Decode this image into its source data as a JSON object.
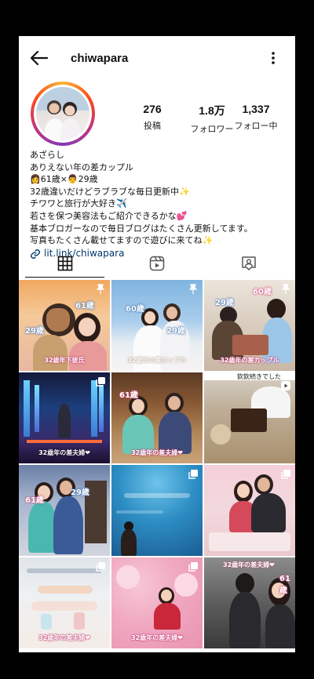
{
  "header": {
    "username": "chiwapara"
  },
  "stats": [
    {
      "number": "276",
      "label": "投稿"
    },
    {
      "number": "1.8万",
      "label": "フォロワー"
    },
    {
      "number": "1,337",
      "label": "フォロー中"
    }
  ],
  "bio": {
    "name": "あざらし",
    "lines": [
      "ありえない年の差カップル",
      "👩61歳×👨29歳",
      "32歳違いだけどラブラブな毎日更新中✨",
      "チワワと旅行が大好き✈️",
      "若さを保つ美容法もご紹介できるかな💕",
      "基本ブロガーなので毎日ブログはたくさん更新してます。",
      "写真もたくさん載せてますので遊びに来てね✨"
    ],
    "link": "lit.link/chiwapara"
  },
  "tabs": [
    {
      "icon": "grid-icon",
      "active": true
    },
    {
      "icon": "reels-icon",
      "active": false
    },
    {
      "icon": "tagged-icon",
      "active": false
    }
  ],
  "posts": [
    {
      "caption": "32歳年下彼氏",
      "ages": [
        "61歳",
        "29歳"
      ],
      "badge": "pin-icon"
    },
    {
      "caption": "32歳年の差カップル",
      "ages": [
        "60歳",
        "29歳"
      ],
      "badge": "pin-icon"
    },
    {
      "caption": "32歳年の差カップル",
      "ages": [
        "29歳",
        "60歳"
      ],
      "badge": "pin-icon"
    },
    {
      "caption": "32歳年の差夫婦❤",
      "ages": [],
      "badge": "multi-icon"
    },
    {
      "caption": "32歳年の差夫婦❤",
      "ages": [
        "61歳"
      ],
      "badge": "none"
    },
    {
      "caption": "",
      "ages": [],
      "badge": "reel-icon",
      "top_text": "欽欽続きでした"
    },
    {
      "caption": "",
      "ages": [
        "61歳",
        "29歳"
      ],
      "badge": "none"
    },
    {
      "caption": "",
      "ages": [],
      "badge": "multi-icon"
    },
    {
      "caption": "",
      "ages": [],
      "badge": "multi-icon"
    },
    {
      "caption": "32歳年の差夫婦❤",
      "ages": [],
      "badge": "multi-icon"
    },
    {
      "caption": "32歳年の差夫婦❤",
      "ages": [],
      "badge": "multi-icon"
    },
    {
      "caption": "",
      "ages": [
        "61歳"
      ],
      "badge": "none",
      "top_text": "32歳年の差夫婦❤"
    }
  ]
}
